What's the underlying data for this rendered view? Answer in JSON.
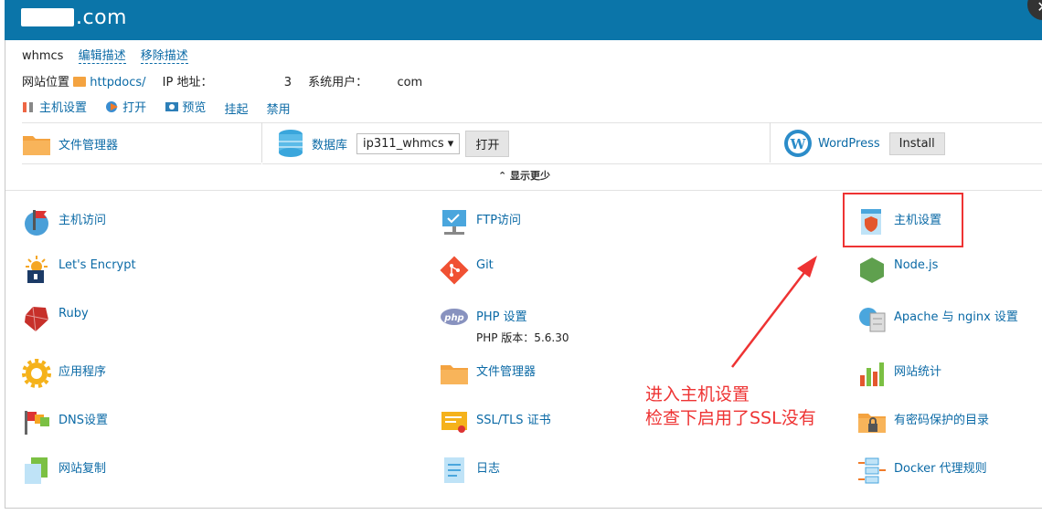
{
  "header": {
    "domain_suffix": ".com"
  },
  "info": {
    "name": "whmcs",
    "edit_desc": "编辑描述",
    "remove_desc": "移除描述",
    "site_location_label": "网站位置",
    "site_location_link": "httpdocs/",
    "ip_label": "IP 地址：",
    "ip_tail": "3",
    "sys_user_label": "系统用户：",
    "sys_user_tail": "com"
  },
  "actions": {
    "host_settings": "主机设置",
    "open": "打开",
    "preview": "预览",
    "suspend": "挂起",
    "disable": "禁用"
  },
  "toolbar": {
    "file_manager": "文件管理器",
    "database": "数据库",
    "db_select": "ip311_whmcs",
    "open": "打开",
    "wordpress": "WordPress",
    "install": "Install"
  },
  "show_less": "显示更少",
  "tiles": {
    "col1": [
      "主机访问",
      "Let's Encrypt",
      "Ruby",
      "应用程序",
      "DNS设置",
      "网站复制"
    ],
    "col2": [
      "FTP访问",
      "Git",
      "PHP 设置",
      "文件管理器",
      "SSL/TLS 证书",
      "日志"
    ],
    "col3": [
      "主机设置",
      "Node.js",
      "Apache 与 nginx 设置",
      "网站统计",
      "有密码保护的目录",
      "Docker 代理规则"
    ],
    "php_version": "PHP 版本：5.6.30"
  },
  "annotation": {
    "line1": "进入主机设置",
    "line2": "检查下启用了SSL没有"
  },
  "colors": {
    "header": "#0b75a9",
    "link": "#0b6aa6",
    "annotation": "#e33333"
  }
}
